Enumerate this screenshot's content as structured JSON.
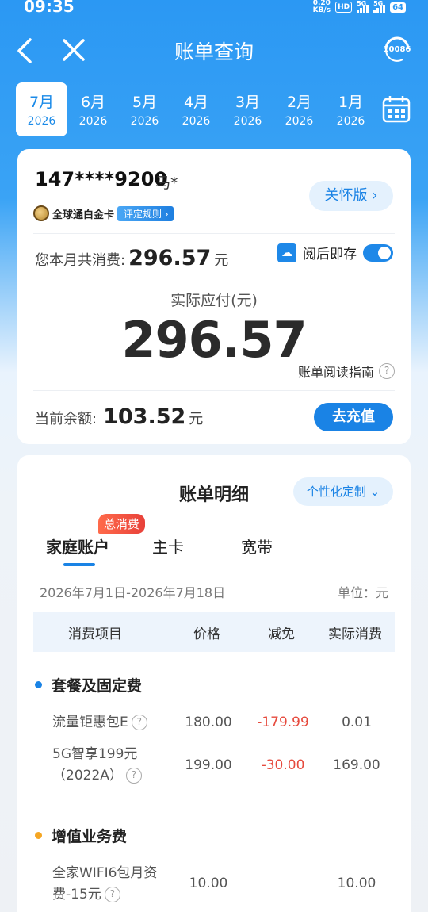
{
  "status_bar": {
    "time": "09:35",
    "net_speed_top": "0.20",
    "net_speed_bottom": "KB/s",
    "hd": "HD",
    "sig1": "5G",
    "sig2": "5G",
    "battery": "64"
  },
  "nav": {
    "title": "账单查询",
    "service_number": "10086"
  },
  "months": [
    {
      "month": "7月",
      "year": "2026",
      "active": true
    },
    {
      "month": "6月",
      "year": "2026"
    },
    {
      "month": "5月",
      "year": "2026"
    },
    {
      "month": "4月",
      "year": "2026"
    },
    {
      "month": "3月",
      "year": "2026"
    },
    {
      "month": "2月",
      "year": "2026"
    },
    {
      "month": "1月",
      "year": "2026"
    }
  ],
  "summary": {
    "phone": "147****9200",
    "name": "马*",
    "level": "全球通白金卡",
    "rule": "评定规则",
    "care_label": "关怀版",
    "monthly_label": "您本月共消费:",
    "monthly_value": "296.57",
    "unit": "元",
    "save_label": "阅后即存",
    "save_on": true,
    "payable_label": "实际应付(元)",
    "payable_value": "296.57",
    "guide_label": "账单阅读指南",
    "balance_label": "当前余额:",
    "balance_value": "103.52",
    "recharge_label": "去充值"
  },
  "detail": {
    "title": "账单明细",
    "custom_label": "个性化定制",
    "tabs": [
      "家庭账户",
      "主卡",
      "宽带"
    ],
    "bubble": "总消费",
    "period": "2026年7月1日-2026年7月18日",
    "unit_label": "单位：元",
    "headers": [
      "消费项目",
      "价格",
      "减免",
      "实际消费"
    ],
    "sections": [
      {
        "title": "套餐及固定费",
        "color": "#1a83e5",
        "rows": [
          {
            "name": "流量钜惠包E",
            "price": "180.00",
            "discount": "-179.99",
            "actual": "0.01"
          },
          {
            "name_line1": "5G智享199元",
            "name_line2": "（2022A）",
            "price": "199.00",
            "discount": "-30.00",
            "actual": "169.00"
          }
        ]
      },
      {
        "title": "增值业务费",
        "color": "#f5a623",
        "rows": [
          {
            "name_line1": "全家WIFI6包月资",
            "name_line2": "费-15元",
            "price": "10.00",
            "discount": "",
            "actual": "10.00"
          }
        ]
      }
    ]
  }
}
